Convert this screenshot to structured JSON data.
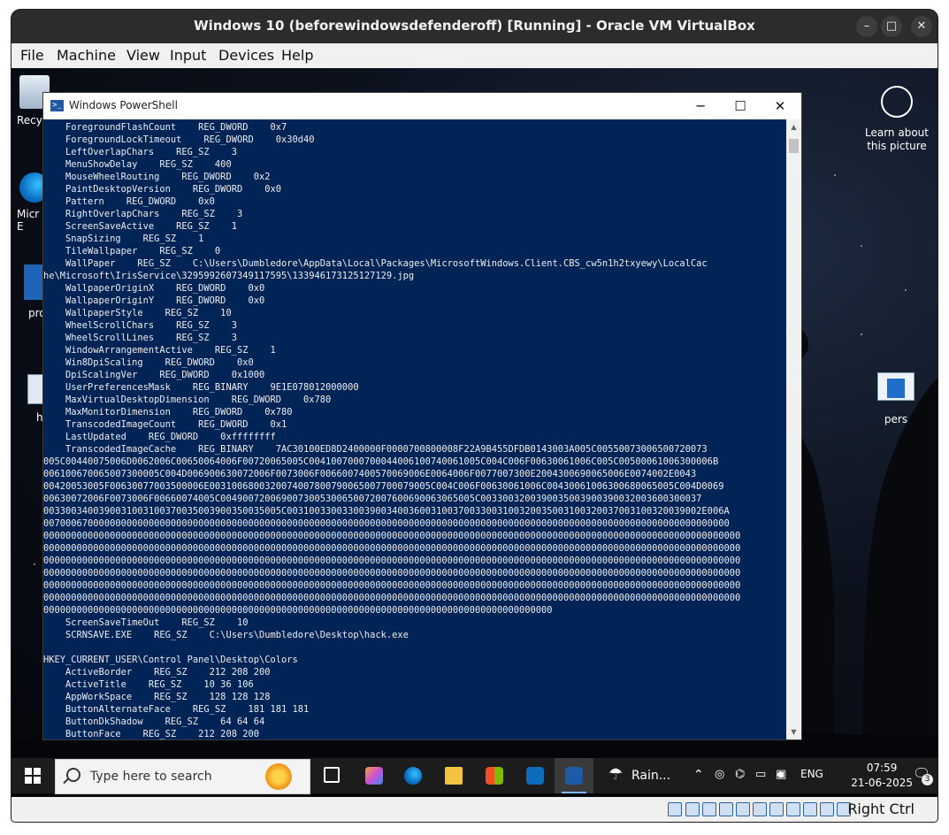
{
  "vbox": {
    "title": "Windows 10 (beforewindowsdefenderoff) [Running] - Oracle VM VirtualBox",
    "minimize": "–",
    "maximize": "□",
    "close": "✕",
    "menu": [
      "File",
      "Machine",
      "View",
      "Input",
      "Devices",
      "Help"
    ],
    "host_key": "Right Ctrl"
  },
  "desktop": {
    "icons_left": [
      "Recy",
      "Micr\nE",
      "pro",
      "h"
    ],
    "learn_label": "Learn about this picture",
    "pers_label": "pers"
  },
  "powershell": {
    "title": "Windows PowerShell",
    "minimize": "─",
    "maximize": "☐",
    "close": "✕",
    "lines": [
      "    ForegroundFlashCount    REG_DWORD    0x7",
      "    ForegroundLockTimeout    REG_DWORD    0x30d40",
      "    LeftOverlapChars    REG_SZ    3",
      "    MenuShowDelay    REG_SZ    400",
      "    MouseWheelRouting    REG_DWORD    0x2",
      "    PaintDesktopVersion    REG_DWORD    0x0",
      "    Pattern    REG_DWORD    0x0",
      "    RightOverlapChars    REG_SZ    3",
      "    ScreenSaveActive    REG_SZ    1",
      "    SnapSizing    REG_SZ    1",
      "    TileWallpaper    REG_SZ    0",
      "    WallPaper    REG_SZ    C:\\Users\\Dumbledore\\AppData\\Local\\Packages\\MicrosoftWindows.Client.CBS_cw5n1h2txyewy\\LocalCac",
      "he\\Microsoft\\IrisService\\3295992607349117595\\133946173125127129.jpg",
      "    WallpaperOriginX    REG_DWORD    0x0",
      "    WallpaperOriginY    REG_DWORD    0x0",
      "    WallpaperStyle    REG_SZ    10",
      "    WheelScrollChars    REG_SZ    3",
      "    WheelScrollLines    REG_SZ    3",
      "    WindowArrangementActive    REG_SZ    1",
      "    Win8DpiScaling    REG_DWORD    0x0",
      "    DpiScalingVer    REG_DWORD    0x1000",
      "    UserPreferencesMask    REG_BINARY    9E1E078012000000",
      "    MaxVirtualDesktopDimension    REG_DWORD    0x780",
      "    MaxMonitorDimension    REG_DWORD    0x780",
      "    TranscodedImageCount    REG_DWORD    0x1",
      "    LastUpdated    REG_DWORD    0xffffffff",
      "    TranscodedImageCache    REG_BINARY    7AC30100ED8D2400000F0000700800008F22A9B455DFDB0143003A005C00550073006500720073",
      "005C00440075006D0062006C00650064006F00720065005C0041007000700044006100740061005C004C006F00630061006C005C00500061006300006B",
      "006100670065007300005C004D006900630072006F0073006F0066007400570069006E0064006F0077007300E2004300690065006E0074002E0043",
      "00420053005F00630077003500006E0031006800320074007800790065007700079005C004C006F00630061006C00430061006300680065005C004D0069",
      "00630072006F0073006F00660074005C0049007200690073005300650072007600690063065005C0033003200390035003900390032003600300037",
      "0033003400390031003100370035003900350035005C003100330033003900340036003100370033003100320035003100320037003100320039002E006A",
      "0070006700000000000000000000000000000000000000000000000000000000000000000000000000000000000000000000000000000000000000000000",
      "000000000000000000000000000000000000000000000000000000000000000000000000000000000000000000000000000000000000000000000000000000",
      "000000000000000000000000000000000000000000000000000000000000000000000000000000000000000000000000000000000000000000000000000000",
      "000000000000000000000000000000000000000000000000000000000000000000000000000000000000000000000000000000000000000000000000000000",
      "000000000000000000000000000000000000000000000000000000000000000000000000000000000000000000000000000000000000000000000000000000",
      "000000000000000000000000000000000000000000000000000000000000000000000000000000000000000000000000000000000000000000000000000000",
      "000000000000000000000000000000000000000000000000000000000000000000000000000000000000000000000000000000000000000000000000000000",
      "00000000000000000000000000000000000000000000000000000000000000000000000000000000000000000000",
      "    ScreenSaveTimeOut    REG_SZ    10",
      "    SCRNSAVE.EXE    REG_SZ    C:\\Users\\Dumbledore\\Desktop\\hack.exe",
      "",
      "HKEY_CURRENT_USER\\Control Panel\\Desktop\\Colors",
      "    ActiveBorder    REG_SZ    212 208 200",
      "    ActiveTitle    REG_SZ    10 36 106",
      "    AppWorkSpace    REG_SZ    128 128 128",
      "    ButtonAlternateFace    REG_SZ    181 181 181",
      "    ButtonDkShadow    REG_SZ    64 64 64",
      "    ButtonFace    REG_SZ    212 208 200"
    ]
  },
  "taskbar": {
    "search_placeholder": "Type here to search",
    "weather": "Rain...",
    "language": "ENG",
    "time": "07:59",
    "date": "21-06-2025",
    "notification_count": "3"
  },
  "colors": {
    "console_bg": "#012456",
    "console_fg": "#eeedf0",
    "taskbar_bg": "#1c1c1c"
  }
}
